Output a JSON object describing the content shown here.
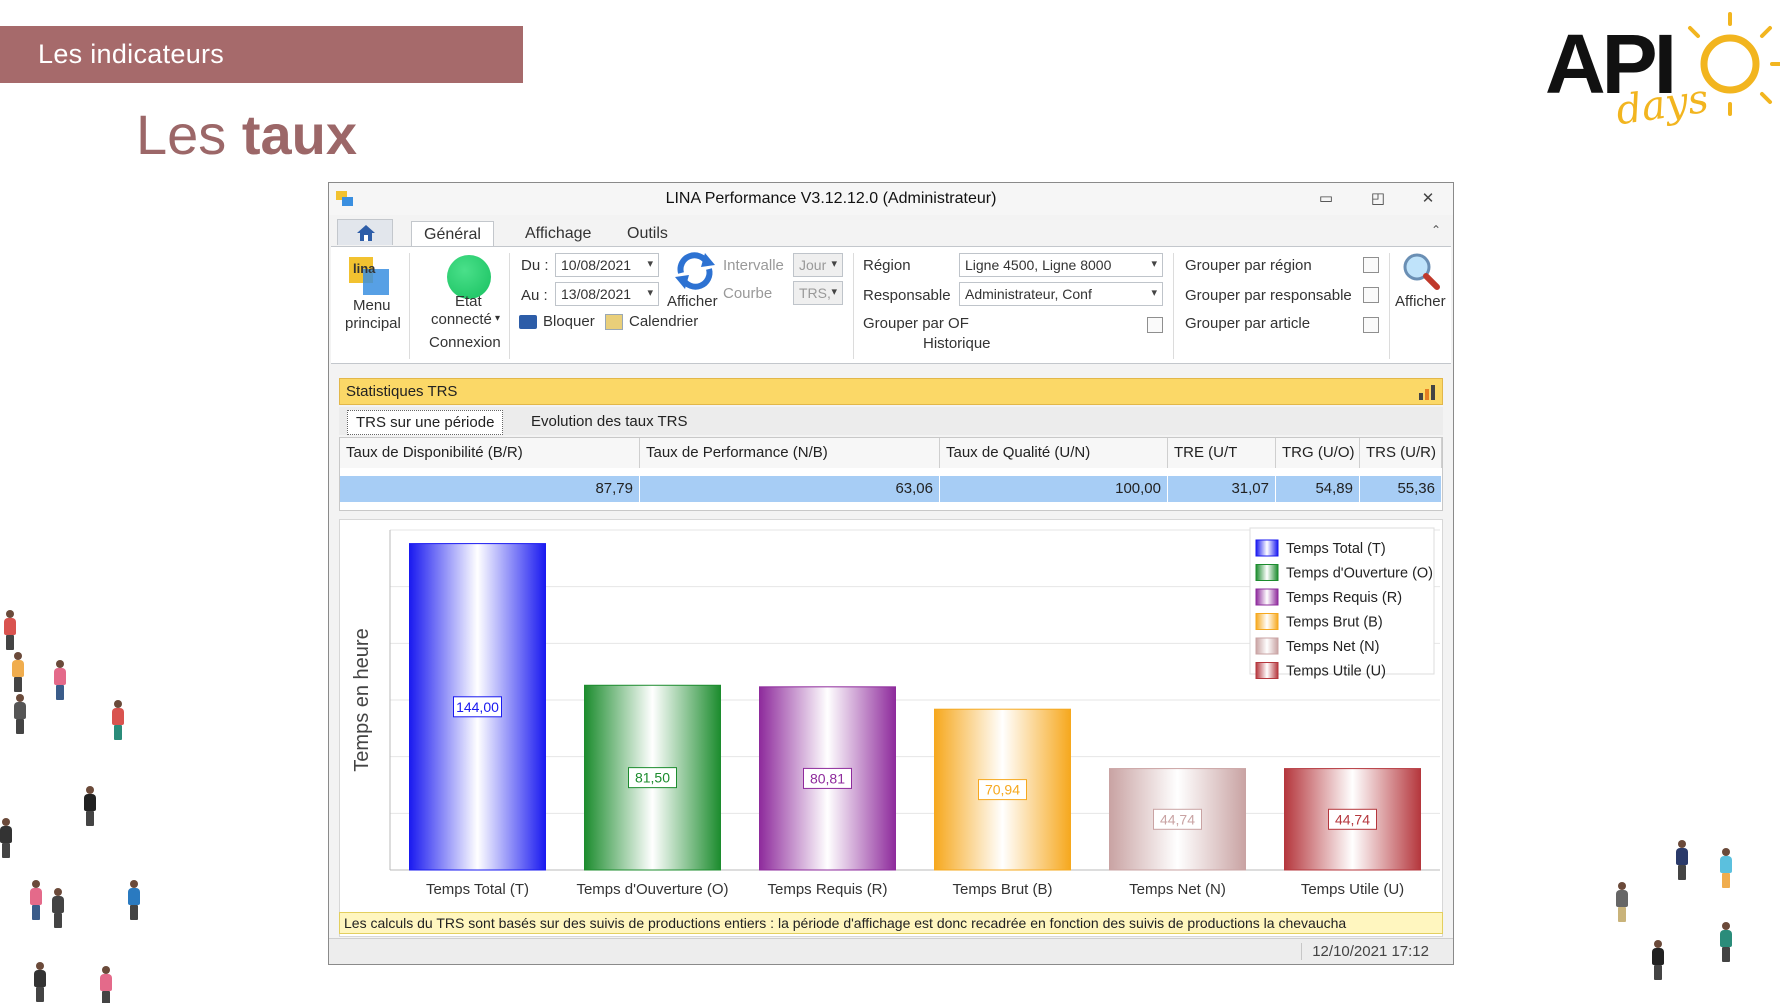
{
  "slide": {
    "banner": "Les indicateurs",
    "title_regular": "Les",
    "title_bold": "taux",
    "logo_main": "API",
    "logo_sub": "days"
  },
  "window": {
    "title": "LINA Performance  V3.12.12.0  (Administrateur)",
    "tabs": [
      "Général",
      "Affichage",
      "Outils"
    ],
    "active_tab": "Général"
  },
  "ribbon": {
    "menu_label_1": "Menu",
    "menu_label_2": "principal",
    "menu_logo": "lina",
    "etat_label_1": "Etat",
    "etat_label_2": "connecté",
    "group_connexion": "Connexion",
    "du_label": "Du :",
    "du_value": "10/08/2021",
    "au_label": "Au :",
    "au_value": "13/08/2021",
    "bloquer": "Bloquer",
    "calendrier": "Calendrier",
    "afficher_small": "Afficher",
    "intervalle_label": "Intervalle",
    "intervalle_value": "Jour",
    "courbe_label": "Courbe",
    "courbe_value": "TRS,",
    "region_label": "Région",
    "region_value": "Ligne 4500, Ligne 8000",
    "responsable_label": "Responsable",
    "responsable_value": "Administrateur, Conf",
    "grouper_of": "Grouper par OF",
    "group_historique": "Historique",
    "grouper_region": "Grouper par région",
    "grouper_responsable": "Grouper par responsable",
    "grouper_article": "Grouper par article",
    "afficher": "Afficher"
  },
  "panel": {
    "header": "Statistiques TRS",
    "subtabs": [
      "TRS sur une période",
      "Evolution des taux TRS"
    ]
  },
  "grid": {
    "headers": [
      "Taux de Disponibilité (B/R)",
      "Taux de Performance (N/B)",
      "Taux de Qualité (U/N)",
      "TRE (U/T",
      "TRG (U/O)",
      "TRS (U/R)"
    ],
    "values": [
      "87,79",
      "63,06",
      "100,00",
      "31,07",
      "54,89",
      "55,36"
    ]
  },
  "chart_data": {
    "type": "bar",
    "ylabel": "Temps en heure",
    "xlabel": "",
    "title": "",
    "ylim": [
      0,
      150
    ],
    "grid": true,
    "legend_position": "top-right",
    "categories": [
      "Temps Total (T)",
      "Temps d'Ouverture (O)",
      "Temps Requis (R)",
      "Temps Brut (B)",
      "Temps Net (N)",
      "Temps Utile (U)"
    ],
    "values": [
      144.0,
      81.5,
      80.81,
      70.94,
      44.74,
      44.74
    ],
    "value_labels": [
      "144,00",
      "81,50",
      "80,81",
      "70,94",
      "44,74",
      "44,74"
    ],
    "colors": [
      "#1a1af0",
      "#1c8c2e",
      "#8e2b9c",
      "#f6a81e",
      "#c9a3a3",
      "#b5373d"
    ],
    "legend": [
      "Temps Total (T)",
      "Temps d'Ouverture (O)",
      "Temps Requis (R)",
      "Temps Brut (B)",
      "Temps Net (N)",
      "Temps Utile (U)"
    ]
  },
  "notice": "Les calculs du TRS sont basés sur des suivis de productions entiers : la période d'affichage est donc recadrée en fonction des suivis de productions la chevaucha",
  "status": {
    "datetime": "12/10/2021 17:12"
  }
}
